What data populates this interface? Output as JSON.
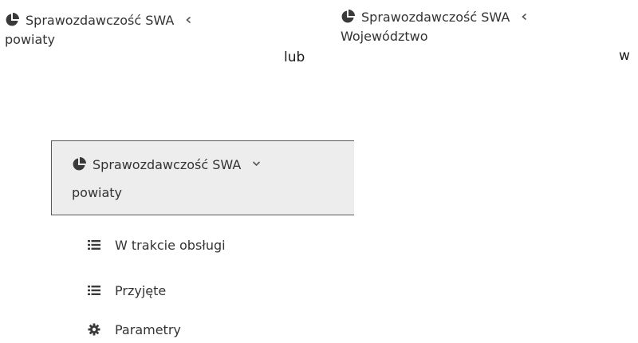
{
  "menus_collapsed": [
    {
      "icon": "pie-chart-icon",
      "title": "Sprawozdawczość SWA",
      "subtitle": "powiaty",
      "chevron": "chevron-left-icon"
    },
    {
      "icon": "pie-chart-icon",
      "title": "Sprawozdawczość SWA",
      "subtitle": "Województwo",
      "chevron": "chevron-left-icon"
    }
  ],
  "connectors": {
    "or_text": "lub",
    "in_text": "w"
  },
  "menu_expanded": {
    "icon": "pie-chart-icon",
    "title": "Sprawozdawczość SWA",
    "subtitle": "powiaty",
    "chevron": "chevron-down-icon",
    "background": "#ededed",
    "items": [
      {
        "icon": "list-icon",
        "label": "W trakcie obsługi"
      },
      {
        "icon": "list-icon",
        "label": "Przyjęte"
      },
      {
        "icon": "gear-icon",
        "label": "Parametry"
      }
    ]
  }
}
